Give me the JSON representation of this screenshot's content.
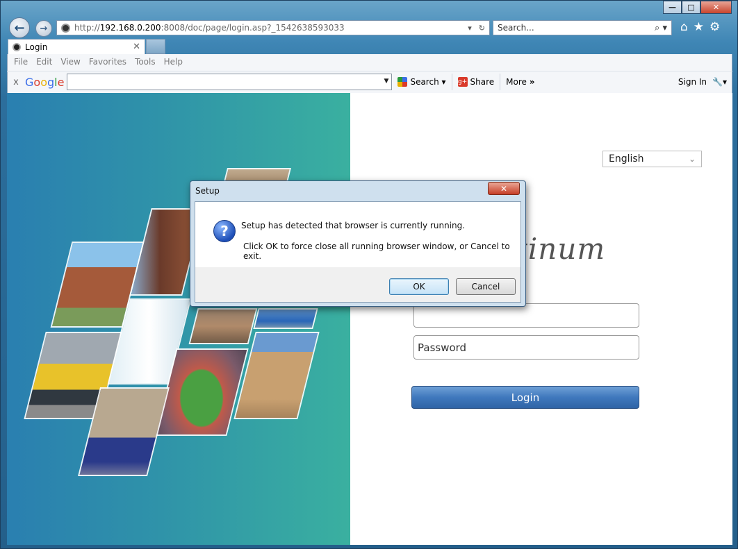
{
  "window": {
    "minimize": "—",
    "maximize": "□",
    "close": "✕"
  },
  "address": {
    "prefix": "http://",
    "host": "192.168.0.200",
    "path": ":8008/doc/page/login.asp?_1542638593033",
    "dropdown": "▾",
    "refresh": "↻"
  },
  "search": {
    "placeholder": "Search...",
    "icon": "⌕ ▾"
  },
  "tab": {
    "title": "Login",
    "close": "✕"
  },
  "menu": [
    "File",
    "Edit",
    "View",
    "Favorites",
    "Tools",
    "Help"
  ],
  "toolbar": {
    "close": "x",
    "google": [
      "G",
      "o",
      "o",
      "g",
      "l",
      "e"
    ],
    "search_label": "Search",
    "share_label": "Share",
    "more_label": "More",
    "more_arrows": "»",
    "sign_in": "Sign In"
  },
  "login": {
    "language": "English",
    "brand": "tinum",
    "username_value": "",
    "password_placeholder": "Password",
    "login_button": "Login"
  },
  "dialog": {
    "title": "Setup",
    "close": "✕",
    "message1": "Setup has detected that browser is currently running.",
    "message2": "Click OK to force close all running browser window, or Cancel to exit.",
    "ok": "OK",
    "cancel": "Cancel"
  },
  "colors": {
    "panel_left": "#2a7fb0",
    "panel_right": "#3ab0a0",
    "login_blue": "#3f78bd"
  }
}
